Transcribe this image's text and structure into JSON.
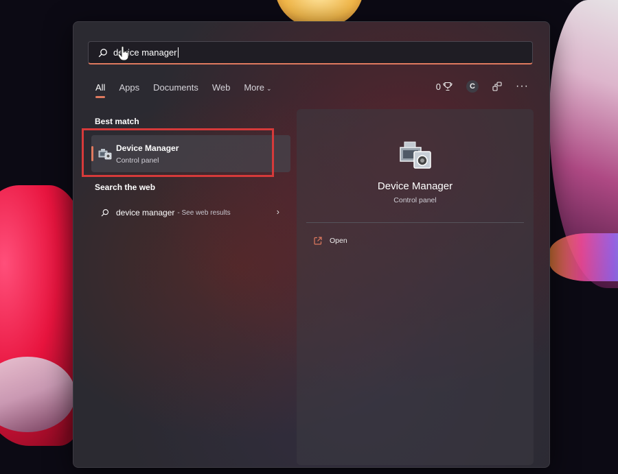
{
  "search": {
    "value": "device manager"
  },
  "tabs": [
    {
      "label": "All",
      "active": true
    },
    {
      "label": "Apps",
      "active": false
    },
    {
      "label": "Documents",
      "active": false
    },
    {
      "label": "Web",
      "active": false
    },
    {
      "label": "More",
      "active": false
    }
  ],
  "toolbar": {
    "rewards_count": "0",
    "account_initial": "C",
    "more": "···"
  },
  "best_match": {
    "heading": "Best match",
    "name": "Device Manager",
    "type": "Control panel"
  },
  "web": {
    "heading": "Search the web",
    "query": "device manager",
    "suffix": "- See web results"
  },
  "detail": {
    "title": "Device Manager",
    "subtitle": "Control panel",
    "actions": [
      {
        "label": "Open",
        "icon": "open-external-icon"
      }
    ]
  },
  "colors": {
    "accent": "#e07a5f",
    "highlight_border": "#d63a3a"
  }
}
